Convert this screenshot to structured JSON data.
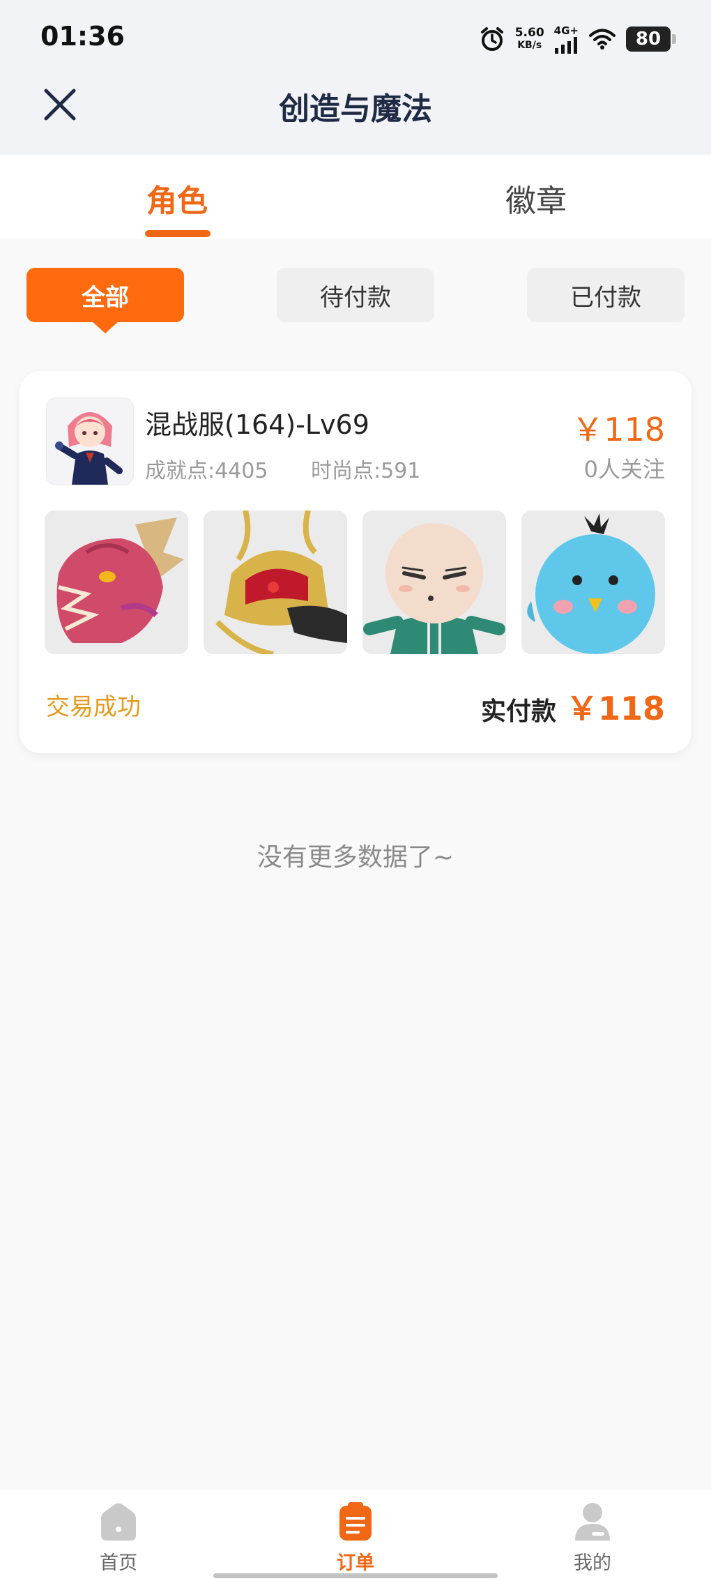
{
  "status_bar": {
    "time": "01:36",
    "net_speed_value": "5.60",
    "net_speed_unit": "KB/s",
    "signal_label": "4G+",
    "battery": "80"
  },
  "header": {
    "title": "创造与魔法"
  },
  "tabs": [
    {
      "label": "角色",
      "active": true
    },
    {
      "label": "徽章",
      "active": false
    }
  ],
  "filters": [
    {
      "label": "全部",
      "selected": true
    },
    {
      "label": "待付款",
      "selected": false
    },
    {
      "label": "已付款",
      "selected": false
    }
  ],
  "order": {
    "name": "混战服(164)-Lv69",
    "achievement": "成就点:4405",
    "fashion": "时尚点:591",
    "price": "￥118",
    "followers": "0人关注",
    "thumbnails": [
      "dragon-head",
      "golden-helmet",
      "bald-character",
      "blue-bird"
    ],
    "status": "交易成功",
    "paid_label": "实付款",
    "paid_amount": "￥118"
  },
  "no_more": "没有更多数据了~",
  "bottom_nav": [
    {
      "label": "首页",
      "icon": "home-icon",
      "active": false
    },
    {
      "label": "订单",
      "icon": "order-icon",
      "active": true
    },
    {
      "label": "我的",
      "icon": "profile-icon",
      "active": false
    }
  ],
  "colors": {
    "accent": "#f06716",
    "success": "#e49a1c",
    "muted": "#9a9a9a"
  }
}
